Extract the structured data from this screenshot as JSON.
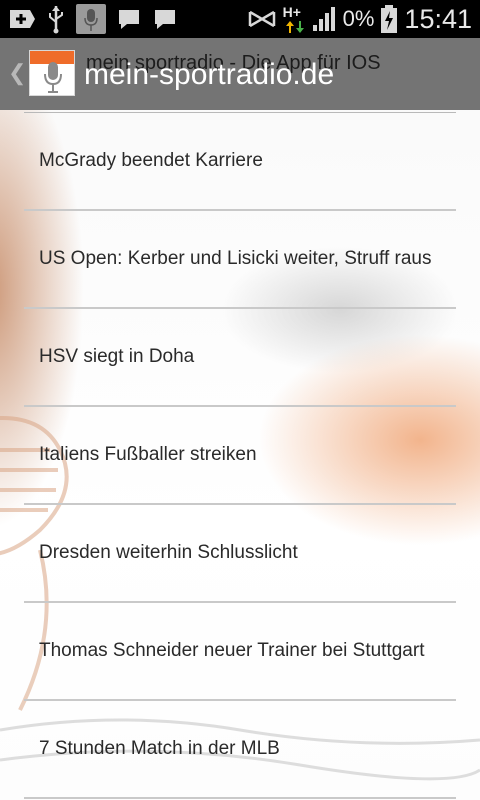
{
  "status_bar": {
    "icons": [
      "plus-icon",
      "usb-icon",
      "app-notification-icon",
      "message-icon",
      "message-icon",
      "no-signal-icon",
      "network-hplus-icon",
      "signal-bars-icon",
      "battery-charging-icon"
    ],
    "network_type": "H+",
    "battery_percent": "0%",
    "time": "15:41"
  },
  "action_bar": {
    "title": "mein-sportradio.de",
    "previous_title": "mein sportradio - Die App für IOS",
    "accent_color": "#ef6c2a"
  },
  "news": [
    {
      "title": "McGrady beendet Karriere"
    },
    {
      "title": "US Open: Kerber und Lisicki weiter, Struff raus"
    },
    {
      "title": "HSV siegt in Doha"
    },
    {
      "title": "Italiens Fußballer streiken"
    },
    {
      "title": "Dresden weiterhin Schlusslicht"
    },
    {
      "title": "Thomas Schneider neuer Trainer bei Stuttgart"
    },
    {
      "title": "7 Stunden Match in der MLB"
    }
  ]
}
